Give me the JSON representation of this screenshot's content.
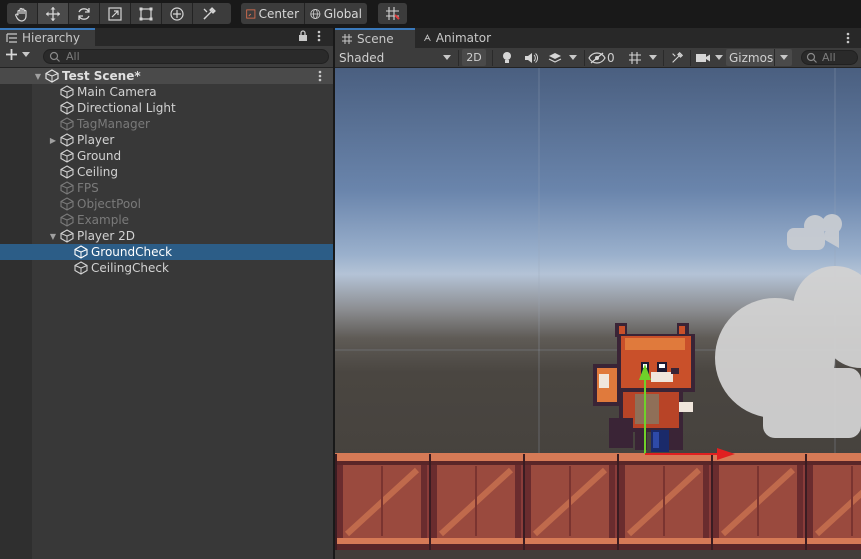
{
  "toolbar": {
    "tools": [
      "hand-tool",
      "move-tool",
      "rotate-tool",
      "scale-tool",
      "rect-tool",
      "transform-tool",
      "custom-tool"
    ],
    "pivot_label": "Center",
    "space_label": "Global"
  },
  "hierarchy": {
    "tab_label": "Hierarchy",
    "search_placeholder": "All",
    "scene_name": "Test Scene*",
    "items": [
      {
        "label": "Main Camera",
        "depth": 1,
        "active": true,
        "expandable": false
      },
      {
        "label": "Directional Light",
        "depth": 1,
        "active": true,
        "expandable": false
      },
      {
        "label": "TagManager",
        "depth": 1,
        "active": false,
        "expandable": false
      },
      {
        "label": "Player",
        "depth": 1,
        "active": true,
        "expandable": true,
        "expanded": false
      },
      {
        "label": "Ground",
        "depth": 1,
        "active": true,
        "expandable": false
      },
      {
        "label": "Ceiling",
        "depth": 1,
        "active": true,
        "expandable": false
      },
      {
        "label": "FPS",
        "depth": 1,
        "active": false,
        "expandable": false
      },
      {
        "label": "ObjectPool",
        "depth": 1,
        "active": false,
        "expandable": false
      },
      {
        "label": "Example",
        "depth": 1,
        "active": false,
        "expandable": false
      },
      {
        "label": "Player 2D",
        "depth": 1,
        "active": true,
        "expandable": true,
        "expanded": true
      },
      {
        "label": "GroundCheck",
        "depth": 2,
        "active": true,
        "expandable": false,
        "selected": true
      },
      {
        "label": "CeilingCheck",
        "depth": 2,
        "active": true,
        "expandable": false
      }
    ]
  },
  "scene": {
    "tabs": [
      {
        "label": "Scene",
        "active": true
      },
      {
        "label": "Animator",
        "active": false
      }
    ],
    "shading_mode": "Shaded",
    "mode_2d_label": "2D",
    "hidden_count": "0",
    "gizmos_label": "Gizmos",
    "search_placeholder": "All"
  },
  "colors": {
    "selection": "#2c5d87",
    "accent_tab": "#3a79bb",
    "gizmo_x": "#e02020",
    "gizmo_y": "#6fd12a"
  }
}
